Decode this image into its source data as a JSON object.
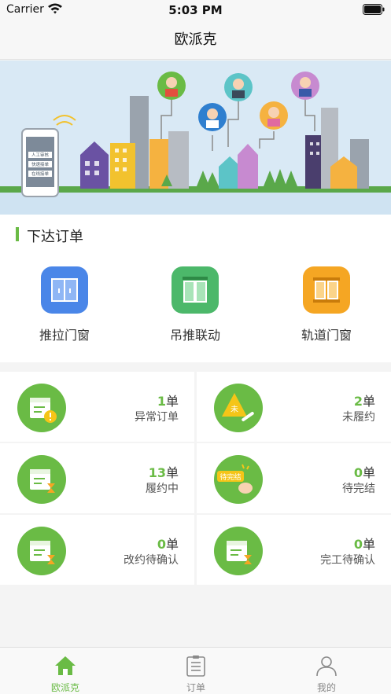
{
  "status_bar": {
    "carrier": "Carrier",
    "time": "5:03 PM"
  },
  "nav": {
    "title": "欧派克"
  },
  "banner": {
    "phone_lines": [
      "人工审核",
      "快速接单",
      "在线接单"
    ]
  },
  "order_section": {
    "title": "下达订单",
    "types": [
      {
        "label": "推拉门窗",
        "icon": "sliding-door-icon",
        "color": "#4a86e8"
      },
      {
        "label": "吊推联动",
        "icon": "hanging-door-icon",
        "color": "#4cb86a"
      },
      {
        "label": "轨道门窗",
        "icon": "track-window-icon",
        "color": "#f5a623"
      }
    ]
  },
  "stats": [
    {
      "count": "1",
      "unit": "单",
      "label": "异常订单",
      "icon": "calendar-warning-icon"
    },
    {
      "count": "2",
      "unit": "单",
      "label": "未履约",
      "icon": "unfulfilled-tool-icon",
      "badge": "未"
    },
    {
      "count": "13",
      "unit": "单",
      "label": "履约中",
      "icon": "calendar-hourglass-icon"
    },
    {
      "count": "0",
      "unit": "单",
      "label": "待完结",
      "icon": "pending-hand-icon",
      "badge": "待完结"
    },
    {
      "count": "0",
      "unit": "单",
      "label": "改约待确认",
      "icon": "calendar-hourglass-icon"
    },
    {
      "count": "0",
      "unit": "单",
      "label": "完工待确认",
      "icon": "calendar-hourglass-icon"
    }
  ],
  "tabs": [
    {
      "label": "欧派克",
      "icon": "home-icon",
      "active": true
    },
    {
      "label": "订单",
      "icon": "order-list-icon",
      "active": false
    },
    {
      "label": "我的",
      "icon": "profile-icon",
      "active": false
    }
  ],
  "colors": {
    "accent": "#6abb45",
    "banner_bg": "#d9e9f5"
  }
}
